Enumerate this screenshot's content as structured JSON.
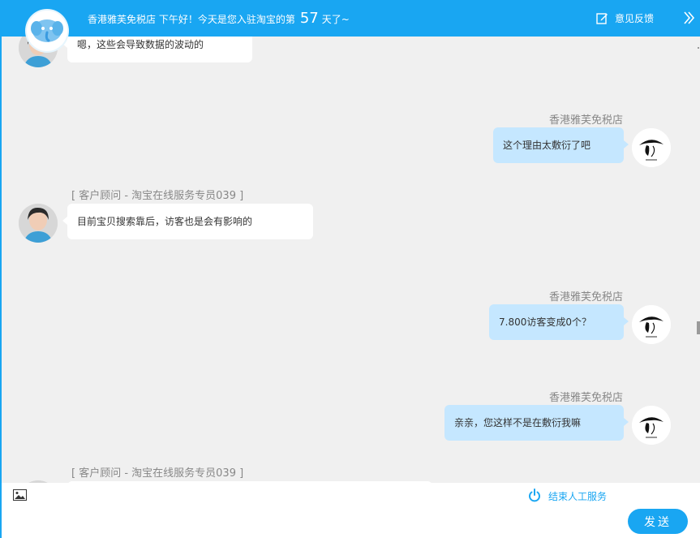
{
  "header": {
    "greeting_prefix": "香港雅芙免税店 下午好！今天是您入驻淘宝的第",
    "days": "57",
    "greeting_suffix": "天了~",
    "feedback_label": "意见反馈"
  },
  "messages": [
    {
      "side": "agent",
      "text": "嗯，这些会导致数据的波动的"
    },
    {
      "side": "me",
      "sender": "香港雅芙免税店",
      "text": "这个理由太敷衍了吧"
    },
    {
      "side": "agent",
      "sender": "[ 客户顾问  -  淘宝在线服务专员039 ]",
      "text": "目前宝贝搜索靠后，访客也是会有影响的"
    },
    {
      "side": "me",
      "sender": "香港雅芙免税店",
      "text": "7.800访客变成0个？"
    },
    {
      "side": "me",
      "sender": "香港雅芙免税店",
      "text": "亲亲，您这样不是在敷衍我嘛"
    },
    {
      "side": "agent",
      "sender": "[ 客户顾问  -  淘宝在线服务专员039 ]",
      "text": ""
    }
  ],
  "footer": {
    "end_service_label": "结束人工服务",
    "send_label": "发送",
    "input_value": ""
  },
  "colors": {
    "accent": "#19a6f2",
    "my_bubble": "#c5e7ff",
    "agent_bubble": "#ffffff",
    "background": "#f0f0f0"
  },
  "icons": {
    "image": "image-icon",
    "power": "power-icon",
    "feedback": "edit-icon",
    "collapse": "double-chevron-right-icon",
    "logo": "elephant-logo"
  }
}
